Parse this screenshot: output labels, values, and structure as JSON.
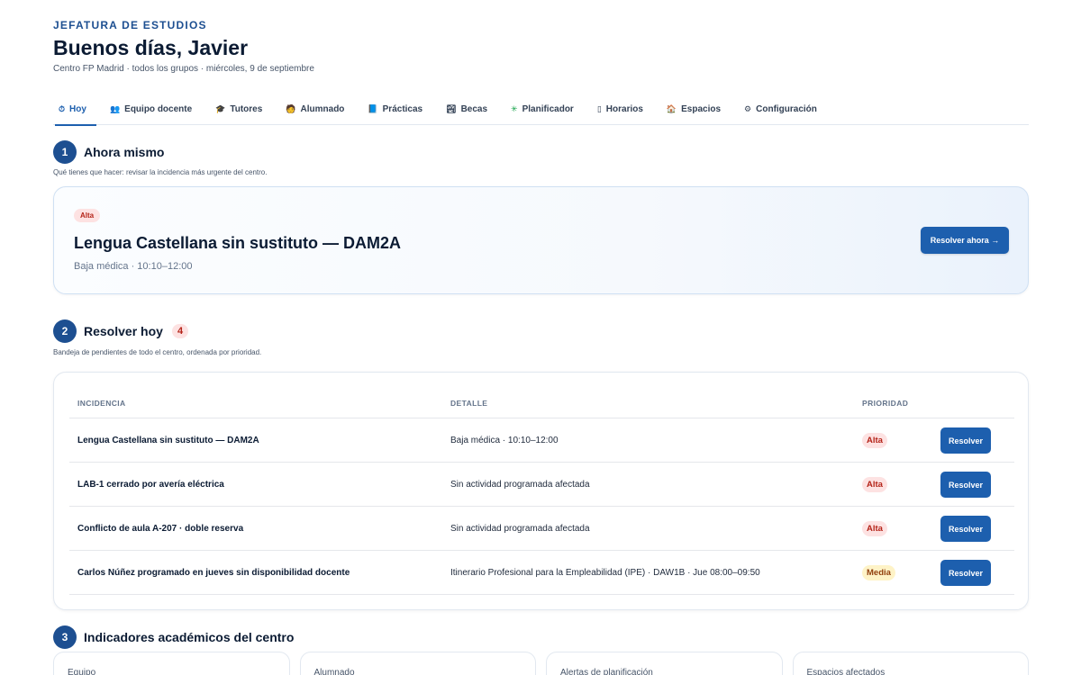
{
  "header": {
    "eyebrow": "JEFATURA DE ESTUDIOS",
    "greeting": "Buenos días, Javier",
    "context": "Centro FP Madrid · todos los grupos · miércoles, 9 de septiembre"
  },
  "tabs": [
    {
      "icon": "⏱",
      "icon_name": "clock-icon",
      "label": "Hoy",
      "active": true
    },
    {
      "icon": "👥",
      "icon_name": "team-icon",
      "label": "Equipo docente"
    },
    {
      "icon": "🎓",
      "icon_name": "graduation-cap-icon",
      "label": "Tutores"
    },
    {
      "icon": "🧑",
      "icon_name": "student-icon",
      "label": "Alumnado"
    },
    {
      "icon": "📘",
      "icon_name": "book-icon",
      "label": "Prácticas"
    },
    {
      "icon": "🏞",
      "icon_name": "scholarship-icon",
      "label": "Becas"
    },
    {
      "icon": "✳",
      "icon_name": "planner-icon",
      "label": "Planificador"
    },
    {
      "icon": "▯",
      "icon_name": "schedule-icon",
      "label": "Horarios"
    },
    {
      "icon": "🏠",
      "icon_name": "building-icon",
      "label": "Espacios"
    },
    {
      "icon": "⚙",
      "icon_name": "gear-icon",
      "label": "Configuración"
    }
  ],
  "now": {
    "number": "1",
    "title": "Ahora mismo",
    "subtitle": "Qué tienes que hacer: revisar la incidencia más urgente del centro.",
    "badge": "Alta",
    "incident": "Lengua Castellana sin sustituto — DAM2A",
    "detail": "Baja médica · 10:10–12:00",
    "button": "Resolver ahora →"
  },
  "today": {
    "number": "2",
    "title": "Resolver hoy",
    "count": "4",
    "subtitle": "Bandeja de pendientes de todo el centro, ordenada por prioridad.",
    "columns": [
      "INCIDENCIA",
      "DETALLE",
      "PRIORIDAD"
    ],
    "rows": [
      {
        "incident": "Lengua Castellana sin sustituto — DAM2A",
        "detail": "Baja médica · 10:10–12:00",
        "priority": "Alta",
        "action": "Resolver"
      },
      {
        "incident": "LAB-1 cerrado por avería eléctrica",
        "detail": "Sin actividad programada afectada",
        "priority": "Alta",
        "action": "Resolver"
      },
      {
        "incident": "Conflicto de aula A-207 · doble reserva",
        "detail": "Sin actividad programada afectada",
        "priority": "Alta",
        "action": "Resolver"
      },
      {
        "incident": "Carlos Núñez programado en jueves sin disponibilidad docente",
        "detail": "Itinerario Profesional para la Empleabilidad (IPE) · DAW1B · Jue 08:00–09:50",
        "priority": "Media",
        "action": "Resolver"
      }
    ]
  },
  "indicators": {
    "number": "3",
    "title": "Indicadores académicos del centro",
    "cards": [
      "Equipo",
      "Alumnado",
      "Alertas de planificación",
      "Espacios afectados"
    ]
  },
  "colors": {
    "accent": "#1d5fae",
    "navy": "#1d4f91",
    "alta_bg": "#fde2e2",
    "alta_fg": "#b42318",
    "media_bg": "#fef3c7",
    "media_fg": "#92400e"
  }
}
